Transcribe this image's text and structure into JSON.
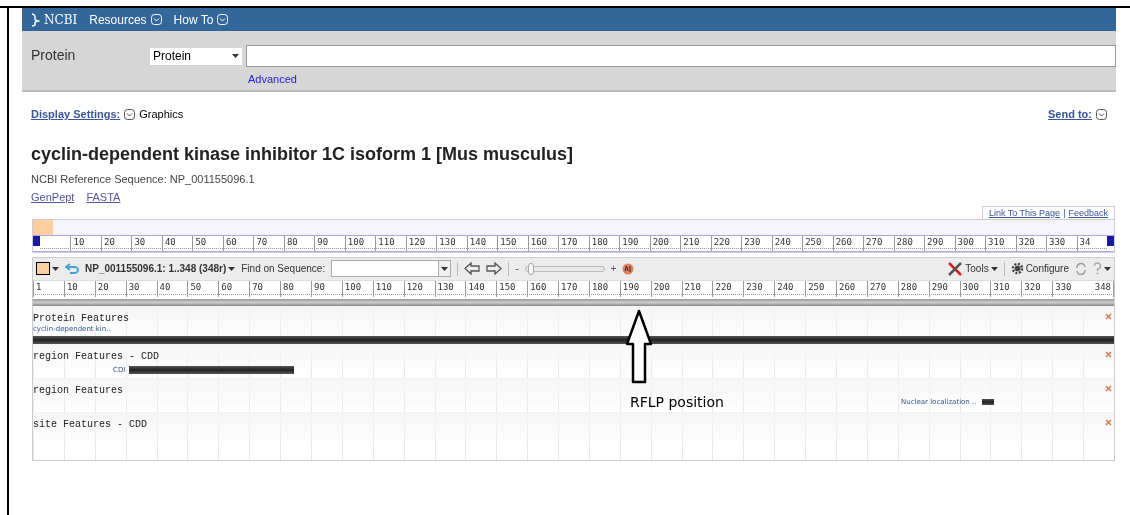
{
  "header": {
    "logo": "NCBI",
    "menus": [
      {
        "label": "Resources"
      },
      {
        "label": "How To"
      }
    ]
  },
  "search": {
    "database_label": "Protein",
    "database_select": "Protein",
    "advanced_link": "Advanced"
  },
  "display": {
    "settings_link": "Display Settings:",
    "mode": "Graphics",
    "send_to": "Send to:"
  },
  "record": {
    "title": "cyclin-dependent kinase inhibitor 1C isoform 1 [Mus musculus]",
    "subtitle": "NCBI Reference Sequence: NP_001155096.1",
    "links": [
      "GenPept",
      "FASTA"
    ]
  },
  "viewer": {
    "top_links": [
      "Link To This Page",
      "Feedback"
    ],
    "separator": "|",
    "overview_ruler": [
      "10",
      "20",
      "30",
      "40",
      "50",
      "60",
      "70",
      "80",
      "90",
      "100",
      "110",
      "120",
      "130",
      "140",
      "150",
      "160",
      "170",
      "180",
      "190",
      "200",
      "210",
      "220",
      "230",
      "240",
      "250",
      "260",
      "270",
      "280",
      "290",
      "300",
      "310",
      "320",
      "330",
      "34"
    ],
    "toolbar": {
      "sequence": "NP_001155096.1: 1..348 (348r)",
      "find_label": "Find on Sequence:",
      "zoom_minus": "-",
      "zoom_plus": "+",
      "zoom": {
        "level": 0.03
      },
      "tools": "Tools",
      "configure": "Configure"
    },
    "ruler": [
      "1",
      "10",
      "20",
      "30",
      "40",
      "50",
      "60",
      "70",
      "80",
      "90",
      "100",
      "110",
      "120",
      "130",
      "140",
      "150",
      "160",
      "170",
      "180",
      "190",
      "200",
      "210",
      "220",
      "230",
      "240",
      "250",
      "260",
      "270",
      "280",
      "290",
      "300",
      "310",
      "320",
      "330",
      "348"
    ],
    "tracks": [
      {
        "title": "Protein Features",
        "features": [
          {
            "label": "cyclin-dependent kin..",
            "kind": "full"
          }
        ]
      },
      {
        "title": "region Features - CDD",
        "features": [
          {
            "label": "CDI",
            "kind": "cdi"
          }
        ]
      },
      {
        "title": "region Features",
        "features": [
          {
            "label": "Nuclear localization ..",
            "kind": "nls"
          }
        ]
      },
      {
        "title": "site Features - CDD"
      }
    ]
  },
  "annotation": {
    "label": "RFLP position"
  }
}
